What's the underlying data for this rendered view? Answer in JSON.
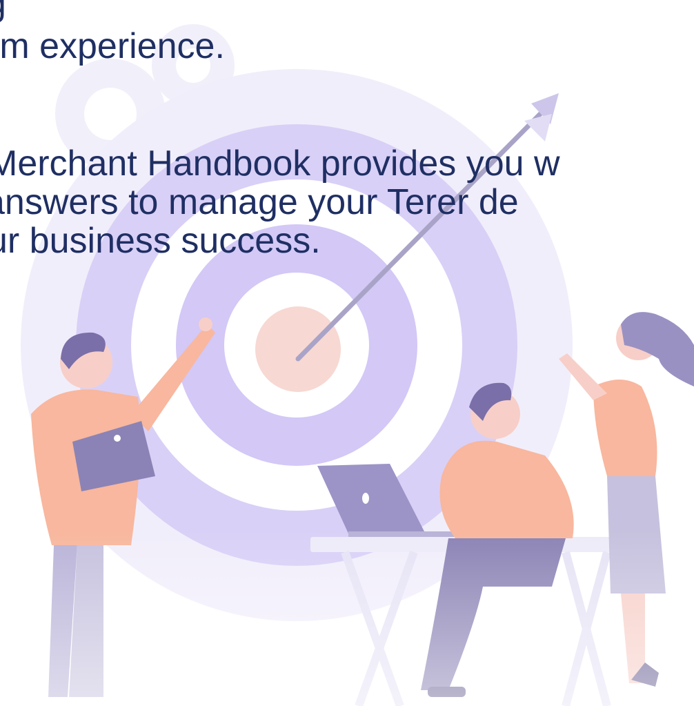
{
  "intro": {
    "line_top": "g",
    "line_experience": "rm experience."
  },
  "handbook": {
    "line1": "Merchant Handbook provides you w",
    "line2": "answers to manage your Terer de",
    "line3": "ur business success."
  },
  "colors": {
    "text": "#1f2f63",
    "target_outer": "#ede9fb",
    "target_ring": "#cfc3f5",
    "target_inner": "#f8d7d2",
    "skin": "#f7cfc8",
    "shirt": "#f8b79e",
    "pants": "#c6c1de",
    "desk": "#ede9fb"
  },
  "icons": {
    "target": "target-icon",
    "gear": "gear-icon",
    "arrow": "arrow-icon"
  }
}
